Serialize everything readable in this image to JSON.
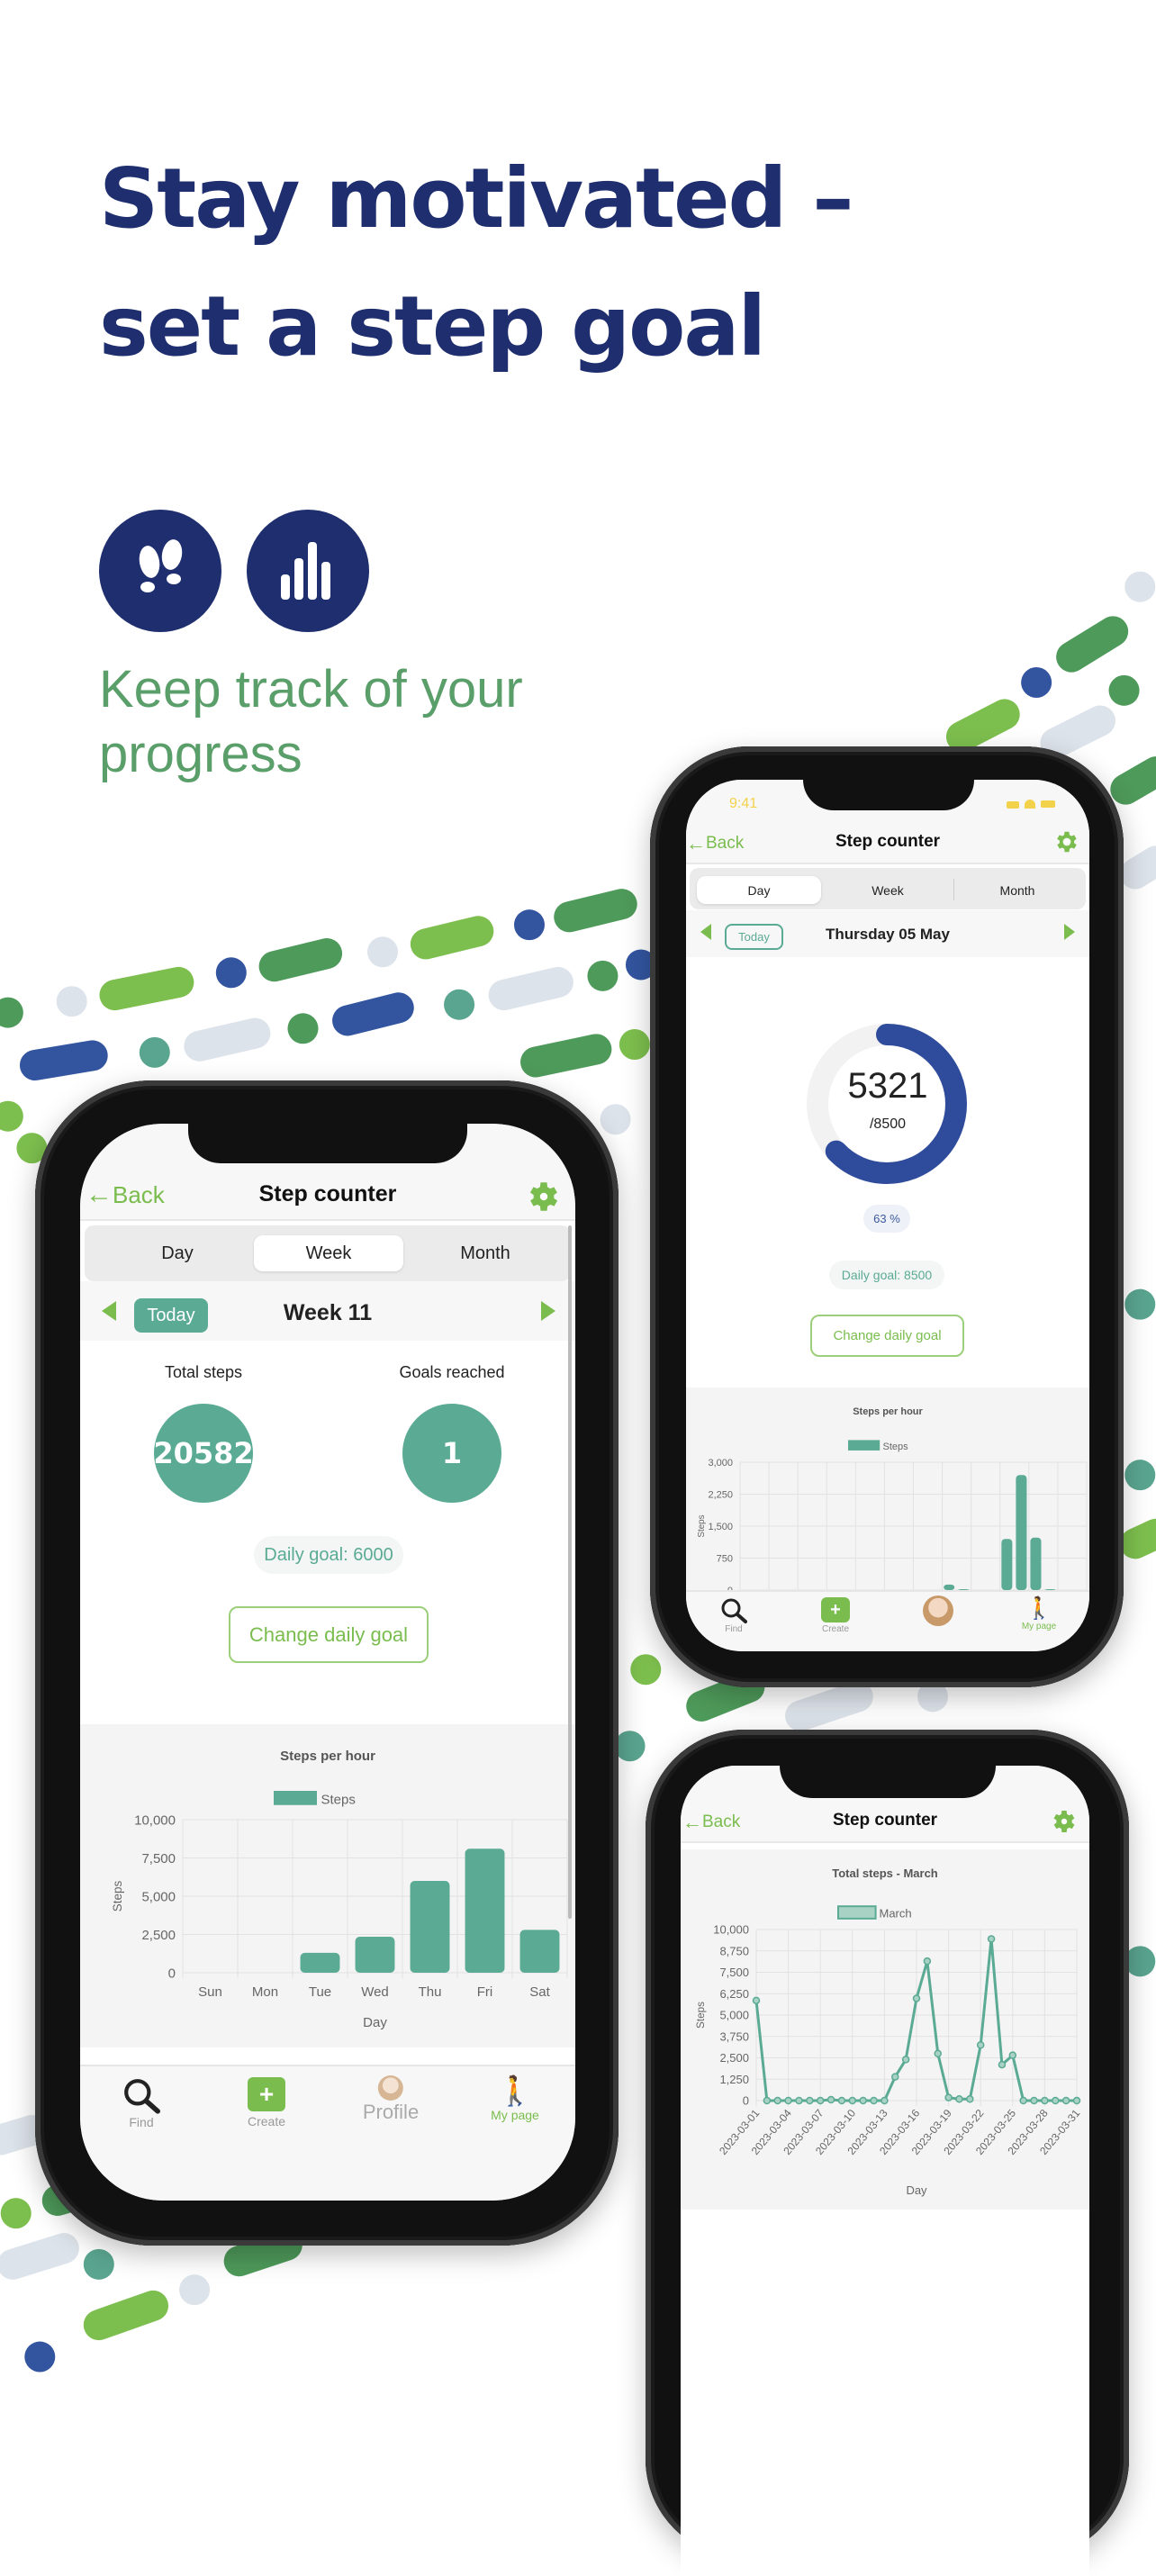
{
  "headline": {
    "line1": "Stay motivated –",
    "line2": "set a step goal"
  },
  "feature_icons": [
    "footprints-icon",
    "bar-chart-icon"
  ],
  "tagline": {
    "line1": "Keep track of your",
    "line2": "progress"
  },
  "colors": {
    "navy": "#1e2e6e",
    "green": "#7abd4e",
    "teal": "#5aaa94",
    "tagline": "#5a9e6a",
    "donut": "#2f4c9c",
    "donut_track": "#f2f2f2"
  },
  "phone_week": {
    "header": {
      "back": "Back",
      "title": "Step counter"
    },
    "tabs": [
      {
        "label": "Day",
        "selected": false
      },
      {
        "label": "Week",
        "selected": true
      },
      {
        "label": "Month",
        "selected": false
      }
    ],
    "date_nav": {
      "today": "Today",
      "label": "Week 11"
    },
    "stats": {
      "total_label": "Total steps",
      "total_value": "20582",
      "goals_label": "Goals reached",
      "goals_value": "1"
    },
    "daily_goal": "Daily goal: 6000",
    "change_goal": "Change daily goal",
    "bottom_nav": [
      {
        "label": "Find",
        "icon": "search-icon"
      },
      {
        "label": "Create",
        "icon": "plus-icon"
      },
      {
        "label": "Profile",
        "icon": "avatar"
      },
      {
        "label": "My page",
        "icon": "walking-icon",
        "active": true
      }
    ]
  },
  "phone_day": {
    "status": {
      "time": "9:41"
    },
    "header": {
      "back": "Back",
      "title": "Step counter"
    },
    "tabs": [
      {
        "label": "Day",
        "selected": true
      },
      {
        "label": "Week",
        "selected": false
      },
      {
        "label": "Month",
        "selected": false
      }
    ],
    "date_nav": {
      "today": "Today",
      "label": "Thursday 05 May"
    },
    "progress": {
      "steps": "5321",
      "goal": "/8500",
      "percent_label": "63 %",
      "fraction": 0.63
    },
    "daily_goal": "Daily goal: 8500",
    "change_goal": "Change daily goal",
    "bottom_nav": [
      {
        "label": "Find",
        "icon": "search-icon"
      },
      {
        "label": "Create",
        "icon": "plus-icon"
      },
      {
        "label": "",
        "icon": "avatar"
      },
      {
        "label": "My page",
        "icon": "walking-icon",
        "active": true
      }
    ]
  },
  "phone_month": {
    "header": {
      "back": "Back",
      "title": "Step counter"
    }
  },
  "chart_data": [
    {
      "type": "bar",
      "title": "Steps per hour",
      "legend": [
        "Steps"
      ],
      "xlabel": "Day",
      "ylabel": "Steps",
      "categories": [
        "Sun",
        "Mon",
        "Tue",
        "Wed",
        "Thu",
        "Fri",
        "Sat"
      ],
      "values": [
        0,
        0,
        1300,
        2350,
        6000,
        8100,
        2800
      ],
      "ylim": [
        0,
        10000
      ],
      "yticks": [
        "10,000",
        "7,500",
        "5,000",
        "2,500",
        "0"
      ],
      "grid": true,
      "legend_position": "top"
    },
    {
      "type": "bar",
      "title": "Steps per hour",
      "legend": [
        "Steps"
      ],
      "ylabel": "Steps",
      "x": [
        14,
        15,
        18,
        19,
        20,
        21
      ],
      "values": [
        130,
        20,
        1200,
        2700,
        1230,
        20
      ],
      "xlim": [
        0,
        24
      ],
      "ylim": [
        0,
        3000
      ],
      "yticks": [
        "3,000",
        "2,250",
        "1,500",
        "750",
        "0"
      ],
      "grid": true,
      "legend_position": "top"
    },
    {
      "type": "line",
      "title": "Total steps - March",
      "legend": [
        "March"
      ],
      "xlabel": "Day",
      "ylabel": "Steps",
      "x": [
        "2023-03-01",
        "2023-03-02",
        "2023-03-03",
        "2023-03-04",
        "2023-03-05",
        "2023-03-06",
        "2023-03-07",
        "2023-03-08",
        "2023-03-09",
        "2023-03-10",
        "2023-03-11",
        "2023-03-12",
        "2023-03-13",
        "2023-03-14",
        "2023-03-15",
        "2023-03-16",
        "2023-03-17",
        "2023-03-18",
        "2023-03-19",
        "2023-03-20",
        "2023-03-21",
        "2023-03-22",
        "2023-03-23",
        "2023-03-24",
        "2023-03-25",
        "2023-03-26",
        "2023-03-27",
        "2023-03-28",
        "2023-03-29",
        "2023-03-30",
        "2023-03-31"
      ],
      "values": [
        5850,
        0,
        0,
        0,
        0,
        0,
        0,
        50,
        0,
        0,
        0,
        0,
        0,
        1390,
        2400,
        5975,
        8150,
        2750,
        175,
        90,
        90,
        3250,
        9450,
        2100,
        2650,
        0,
        0,
        0,
        0,
        0,
        0
      ],
      "xticks": [
        "2023-03-01",
        "2023-03-04",
        "2023-03-07",
        "2023-03-10",
        "2023-03-13",
        "2023-03-16",
        "2023-03-19",
        "2023-03-22",
        "2023-03-25",
        "2023-03-28",
        "2023-03-31"
      ],
      "ylim": [
        0,
        10000
      ],
      "yticks": [
        "10,000",
        "8,750",
        "7,500",
        "6,250",
        "5,000",
        "3,750",
        "2,500",
        "1,250",
        "0"
      ],
      "grid": true,
      "legend_position": "top"
    }
  ]
}
